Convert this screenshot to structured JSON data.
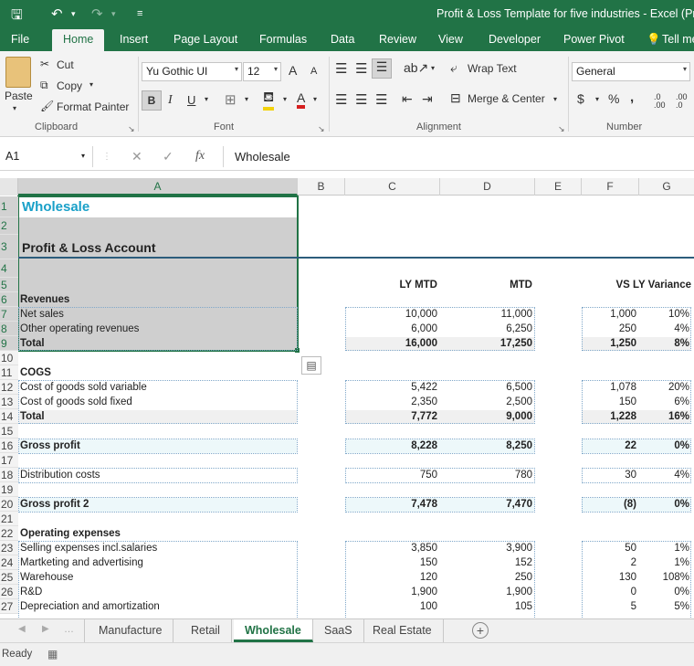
{
  "window": {
    "title": "Profit & Loss Template for five industries - Excel (Prod"
  },
  "ribbon_tabs": [
    "File",
    "Home",
    "Insert",
    "Page Layout",
    "Formulas",
    "Data",
    "Review",
    "View",
    "Developer",
    "Power Pivot",
    "Tell me"
  ],
  "clipboard": {
    "paste": "Paste",
    "cut": "Cut",
    "copy": "Copy",
    "format_painter": "Format Painter",
    "label": "Clipboard"
  },
  "font": {
    "name": "Yu Gothic UI",
    "size": "12",
    "label": "Font",
    "bold": "B",
    "italic": "I",
    "underline": "U",
    "grow": "A",
    "shrink": "A",
    "color": "A"
  },
  "alignment": {
    "wrap": "Wrap Text",
    "merge": "Merge & Center",
    "label": "Alignment"
  },
  "number": {
    "format": "General",
    "currency": "$",
    "percent": "%",
    "comma": ",",
    "label": "Number",
    "inc_dec": ".0 .00",
    "dec_dec": ".00 .0"
  },
  "formula_bar": {
    "name_box": "A1",
    "value": "Wholesale",
    "fx": "fx",
    "cancel": "✕",
    "enter": "✓"
  },
  "columns": [
    "A",
    "B",
    "C",
    "D",
    "E",
    "F",
    "G"
  ],
  "rows": [
    {
      "n": "1",
      "a": "Wholesale"
    },
    {
      "n": "2",
      "a": ""
    },
    {
      "n": "3",
      "a": "Profit & Loss Account"
    },
    {
      "n": "4",
      "a": ""
    },
    {
      "n": "5",
      "a": "",
      "c": "LY MTD",
      "d": "MTD",
      "fg": "VS LY Variance"
    },
    {
      "n": "6",
      "a": "Revenues"
    },
    {
      "n": "7",
      "a": "Net sales",
      "c": "10,000",
      "d": "11,000",
      "f": "1,000",
      "g": "10%"
    },
    {
      "n": "8",
      "a": "Other operating revenues",
      "c": "6,000",
      "d": "6,250",
      "f": "250",
      "g": "4%"
    },
    {
      "n": "9",
      "a": "Total",
      "c": "16,000",
      "d": "17,250",
      "f": "1,250",
      "g": "8%"
    },
    {
      "n": "10",
      "a": ""
    },
    {
      "n": "11",
      "a": "COGS"
    },
    {
      "n": "12",
      "a": "Cost of goods sold variable",
      "c": "5,422",
      "d": "6,500",
      "f": "1,078",
      "g": "20%"
    },
    {
      "n": "13",
      "a": "Cost of goods sold fixed",
      "c": "2,350",
      "d": "2,500",
      "f": "150",
      "g": "6%"
    },
    {
      "n": "14",
      "a": "Total",
      "c": "7,772",
      "d": "9,000",
      "f": "1,228",
      "g": "16%"
    },
    {
      "n": "15",
      "a": ""
    },
    {
      "n": "16",
      "a": "Gross profit",
      "c": "8,228",
      "d": "8,250",
      "f": "22",
      "g": "0%"
    },
    {
      "n": "17",
      "a": ""
    },
    {
      "n": "18",
      "a": "Distribution costs",
      "c": "750",
      "d": "780",
      "f": "30",
      "g": "4%"
    },
    {
      "n": "19",
      "a": ""
    },
    {
      "n": "20",
      "a": "Gross profit 2",
      "c": "7,478",
      "d": "7,470",
      "f": "(8)",
      "g": "0%"
    },
    {
      "n": "21",
      "a": ""
    },
    {
      "n": "22",
      "a": "Operating expenses"
    },
    {
      "n": "23",
      "a": "Selling expenses incl.salaries",
      "c": "3,850",
      "d": "3,900",
      "f": "50",
      "g": "1%"
    },
    {
      "n": "24",
      "a": "Martketing and advertising",
      "c": "150",
      "d": "152",
      "f": "2",
      "g": "1%"
    },
    {
      "n": "25",
      "a": "Warehouse",
      "c": "120",
      "d": "250",
      "f": "130",
      "g": "108%"
    },
    {
      "n": "26",
      "a": "R&D",
      "c": "1,900",
      "d": "1,900",
      "f": "0",
      "g": "0%"
    },
    {
      "n": "27",
      "a": "Depreciation and amortization",
      "c": "100",
      "d": "105",
      "f": "5",
      "g": "5%"
    }
  ],
  "sheet_tabs": [
    "Manufacture",
    "Retail",
    "Wholesale",
    "SaaS",
    "Real Estate"
  ],
  "active_sheet": "Wholesale",
  "status": "Ready",
  "colors": {
    "excel_green": "#217346",
    "title_cyan": "#19a0c8",
    "shade": "#cfcfcf",
    "light_cyan": "#edf8fa",
    "total_gray": "#f0f0f0",
    "rule_blue": "#2c5d7c"
  }
}
